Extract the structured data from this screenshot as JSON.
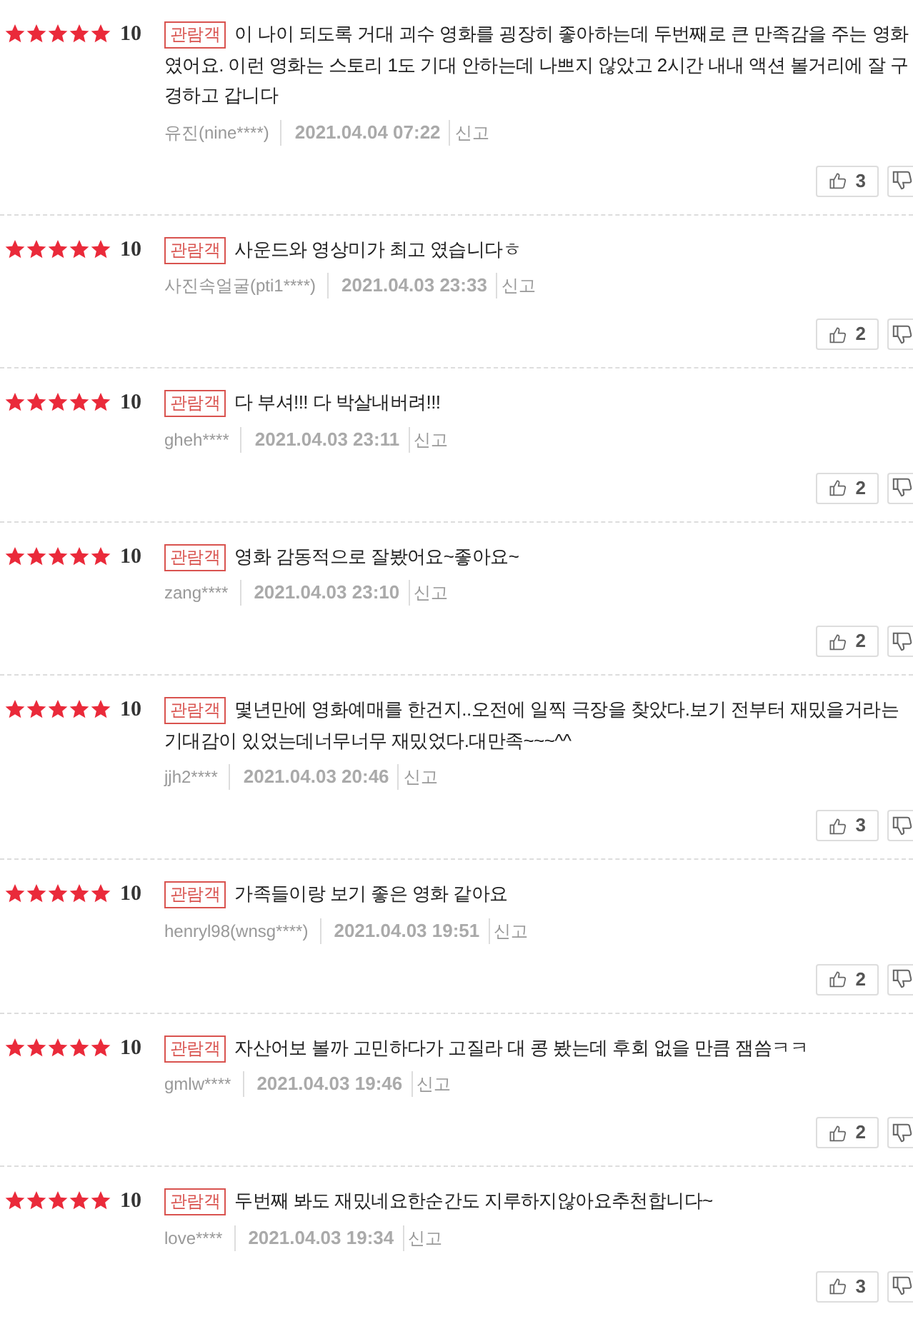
{
  "reviews": [
    {
      "stars": 5,
      "score": "10",
      "badge": "관람객",
      "text": "이 나이 되도록 거대 괴수 영화를 굉장히 좋아하는데 두번째로 큰 만족감을 주는 영화였어요. 이런 영화는 스토리 1도 기대 안하는데 나쁘지 않았고 2시간 내내 액션 볼거리에 잘 구경하고 갑니다",
      "author": "유진(nine****)",
      "date": "2021.04.04 07:22",
      "report": "신고",
      "likes": "3"
    },
    {
      "stars": 5,
      "score": "10",
      "badge": "관람객",
      "text": "사운드와 영상미가 최고 였습니다ㅎ",
      "author": "사진속얼굴(pti1****)",
      "date": "2021.04.03 23:33",
      "report": "신고",
      "likes": "2"
    },
    {
      "stars": 5,
      "score": "10",
      "badge": "관람객",
      "text": "다 부셔!!! 다 박살내버려!!!",
      "author": "gheh****",
      "date": "2021.04.03 23:11",
      "report": "신고",
      "likes": "2"
    },
    {
      "stars": 5,
      "score": "10",
      "badge": "관람객",
      "text": "영화 감동적으로 잘봤어요~좋아요~",
      "author": "zang****",
      "date": "2021.04.03 23:10",
      "report": "신고",
      "likes": "2"
    },
    {
      "stars": 5,
      "score": "10",
      "badge": "관람객",
      "text": "몇년만에 영화예매를 한건지..오전에 일찍 극장을 찾았다.보기 전부터 재밌을거라는 기대감이 있었는데너무너무 재밌었다.대만족~~~^^",
      "author": "jjh2****",
      "date": "2021.04.03 20:46",
      "report": "신고",
      "likes": "3"
    },
    {
      "stars": 5,
      "score": "10",
      "badge": "관람객",
      "text": "가족들이랑 보기 좋은 영화 같아요",
      "author": "henryl98(wnsg****)",
      "date": "2021.04.03 19:51",
      "report": "신고",
      "likes": "2"
    },
    {
      "stars": 5,
      "score": "10",
      "badge": "관람객",
      "text": "자산어보 볼까 고민하다가 고질라 대 콩 봤는데 후회 없을 만큼 잼씀ㅋㅋ",
      "author": "gmlw****",
      "date": "2021.04.03 19:46",
      "report": "신고",
      "likes": "2"
    },
    {
      "stars": 5,
      "score": "10",
      "badge": "관람객",
      "text": "두번째 봐도 재밌네요한순간도 지루하지않아요추천합니다~",
      "author": "love****",
      "date": "2021.04.03 19:34",
      "report": "신고",
      "likes": "3"
    }
  ]
}
